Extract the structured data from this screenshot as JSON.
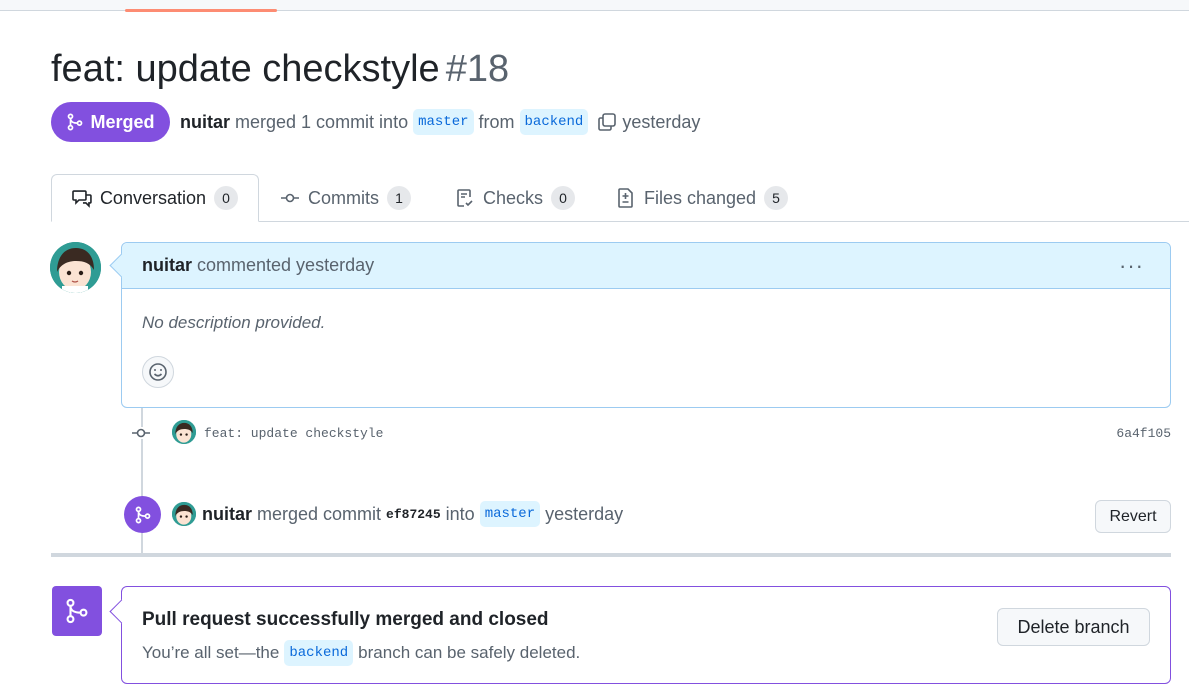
{
  "pr": {
    "title": "feat: update checkstyle",
    "number": "#18",
    "state": "Merged",
    "author": "nuitar",
    "merged_text": "merged 1 commit into",
    "base_branch": "master",
    "from_text": "from",
    "head_branch": "backend",
    "time": "yesterday"
  },
  "tabs": [
    {
      "label": "Conversation",
      "count": "0",
      "icon": "comment-discussion-icon"
    },
    {
      "label": "Commits",
      "count": "1",
      "icon": "git-commit-icon"
    },
    {
      "label": "Checks",
      "count": "0",
      "icon": "checklist-icon"
    },
    {
      "label": "Files changed",
      "count": "5",
      "icon": "file-diff-icon"
    }
  ],
  "comment": {
    "author": "nuitar",
    "action": "commented yesterday",
    "body": "No description provided.",
    "menu": "···"
  },
  "commit": {
    "message": "feat: update checkstyle",
    "sha": "6a4f105"
  },
  "merge_event": {
    "author": "nuitar",
    "action": "merged commit",
    "sha": "ef87245",
    "into_text": "into",
    "branch": "master",
    "time": "yesterday",
    "revert_label": "Revert"
  },
  "merged_box": {
    "title": "Pull request successfully merged and closed",
    "sub_before": "You’re all set—the",
    "branch": "backend",
    "sub_after": "branch can be safely deleted.",
    "delete_label": "Delete branch"
  },
  "colors": {
    "merged_purple": "#8250df",
    "branch_bg": "#ddf4ff",
    "branch_fg": "#0969da",
    "tab_underline": "#fd8c73"
  }
}
